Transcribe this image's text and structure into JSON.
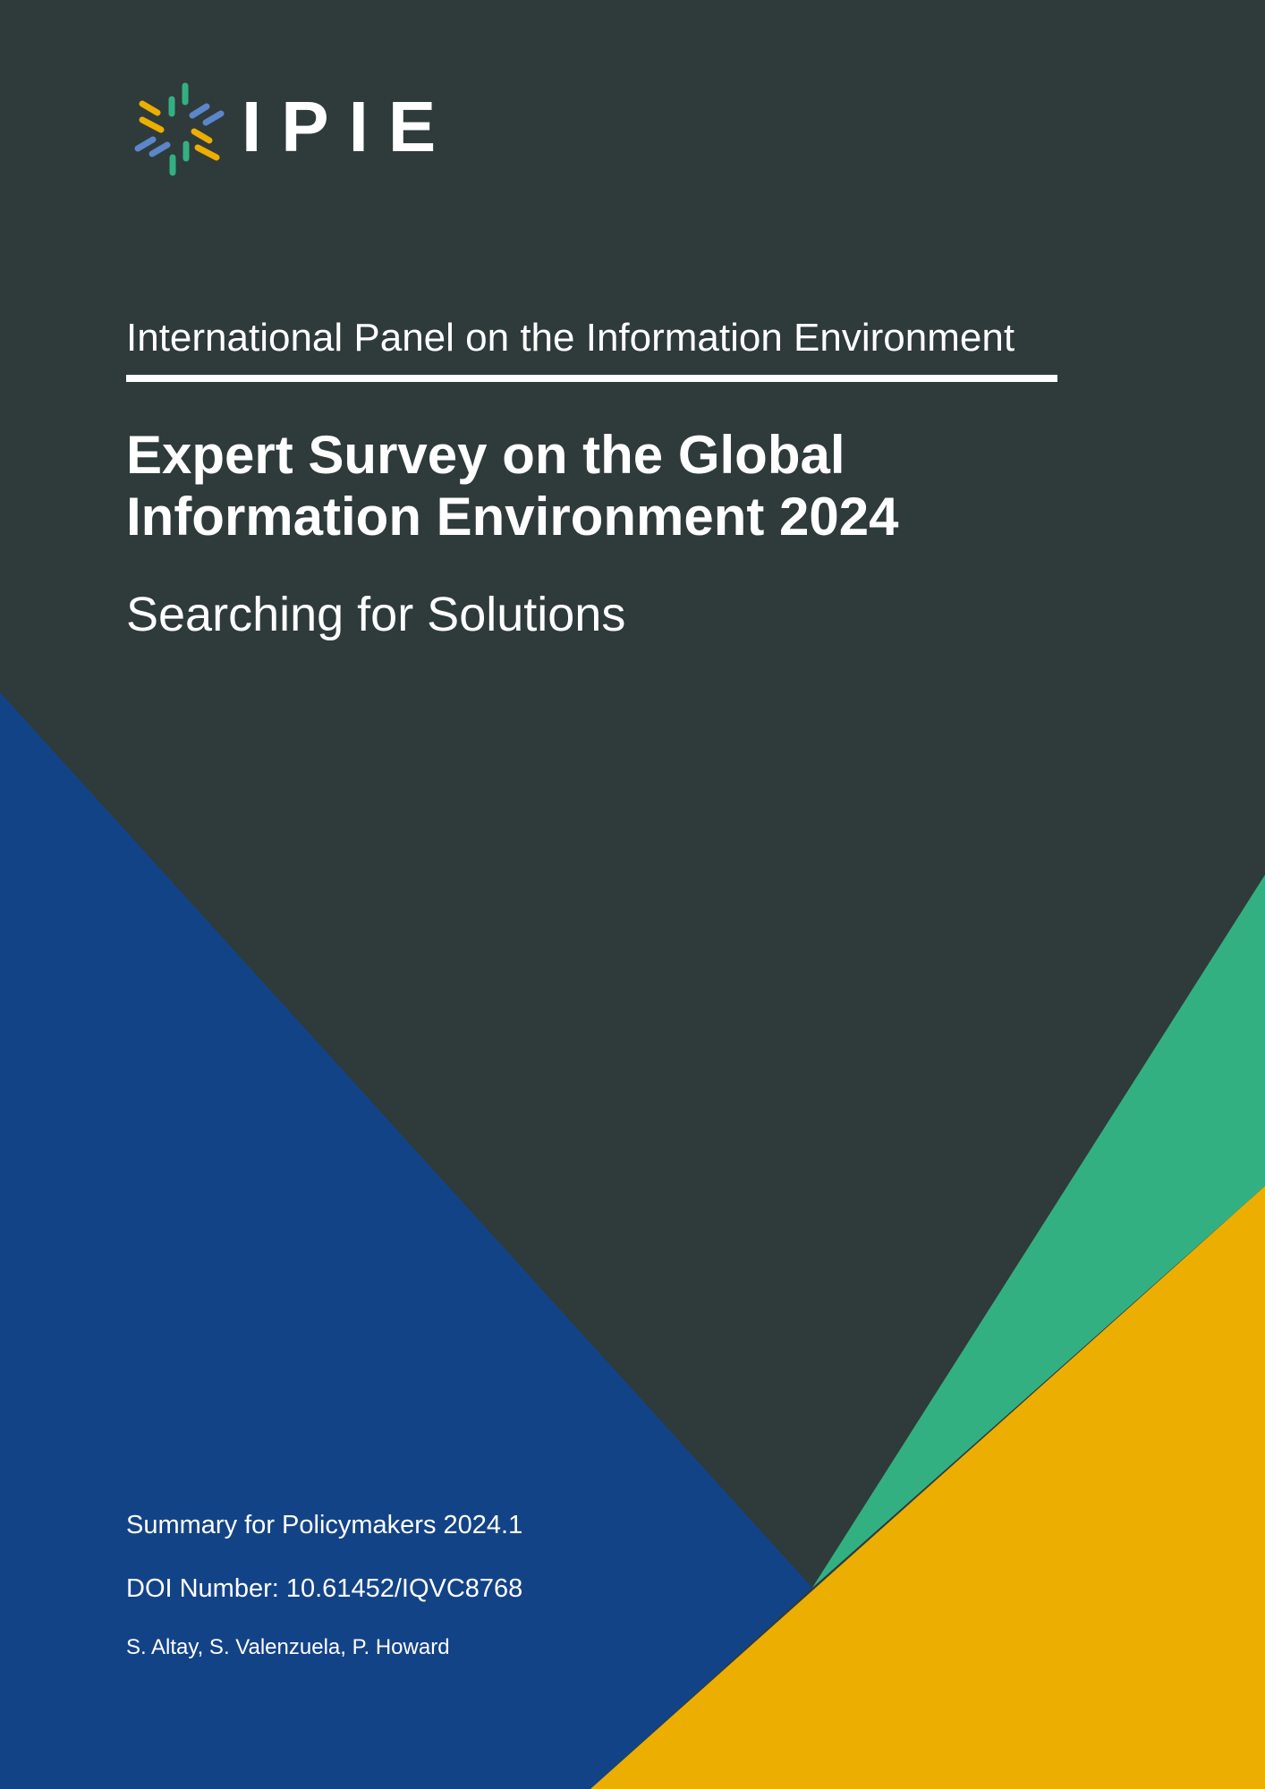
{
  "logo": {
    "wordmark": "IPIE",
    "icon": "ipie-starburst-icon"
  },
  "cover": {
    "org_name": "International Panel on the Information Environment",
    "title_line1": "Expert Survey on the Global",
    "title_line2": "Information Environment 2024",
    "subtitle": "Searching for Solutions",
    "series": "Summary for Policymakers 2024.1",
    "doi": "DOI Number: 10.61452/IQVC8768",
    "authors": "S. Altay, S. Valenzuela, P. Howard"
  },
  "colors": {
    "background": "#2f3a3b",
    "blue": "#134387",
    "green": "#33b082",
    "yellow": "#ecae00",
    "logo_blue": "#5b86c9"
  }
}
